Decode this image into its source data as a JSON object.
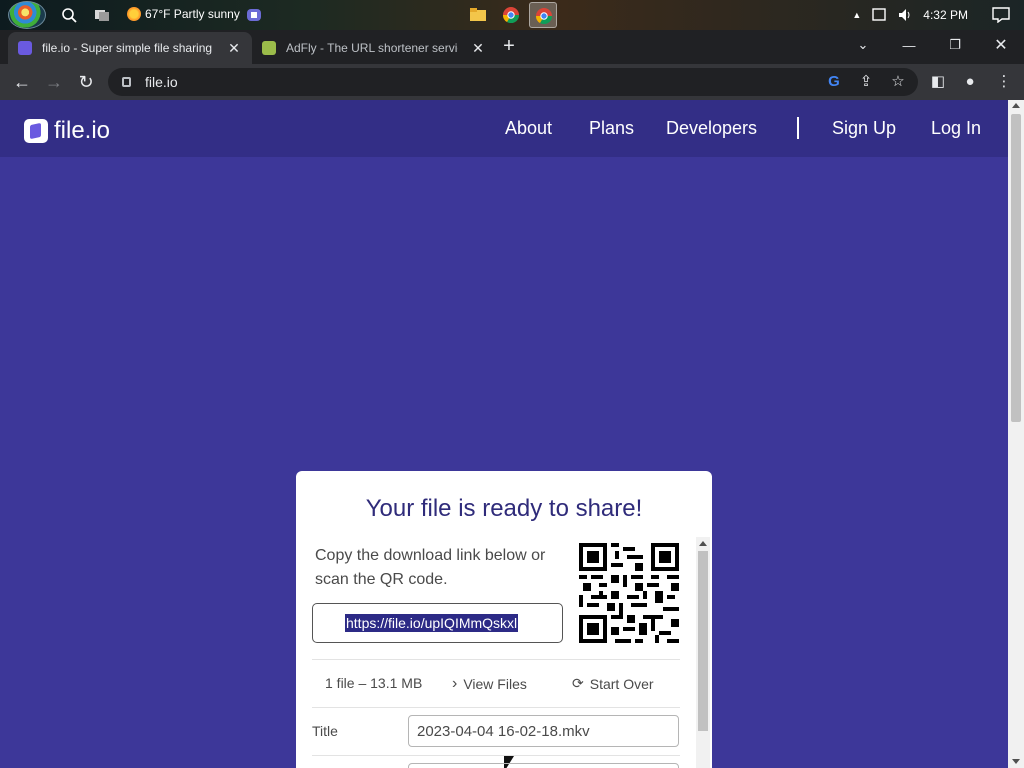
{
  "taskbar": {
    "weather": "67°F Partly sunny",
    "time": "4:32 PM"
  },
  "browser": {
    "tabs": [
      {
        "title": "file.io - Super simple file sharing"
      },
      {
        "title": "AdFly - The URL shortener servic"
      }
    ],
    "address": "file.io"
  },
  "site": {
    "logo_text": "file.io",
    "nav": {
      "about": "About",
      "plans": "Plans",
      "developers": "Developers",
      "signup": "Sign Up",
      "login": "Log In"
    }
  },
  "card": {
    "title": "Your file is ready to share!",
    "instructions": "Copy the download link below or scan the QR code.",
    "link": "https://file.io/upIQIMmQskxl",
    "file_count": "1 file – 13.1 MB",
    "view_files": "View Files",
    "start_over": "Start Over",
    "title_label": "Title",
    "title_value": "2023-04-04 16-02-18.mkv"
  },
  "colors": {
    "page_bg": "#3d3799",
    "header_bg": "#332e86",
    "title_color": "#2f2b7a",
    "link_highlight": "#2c2a86"
  }
}
